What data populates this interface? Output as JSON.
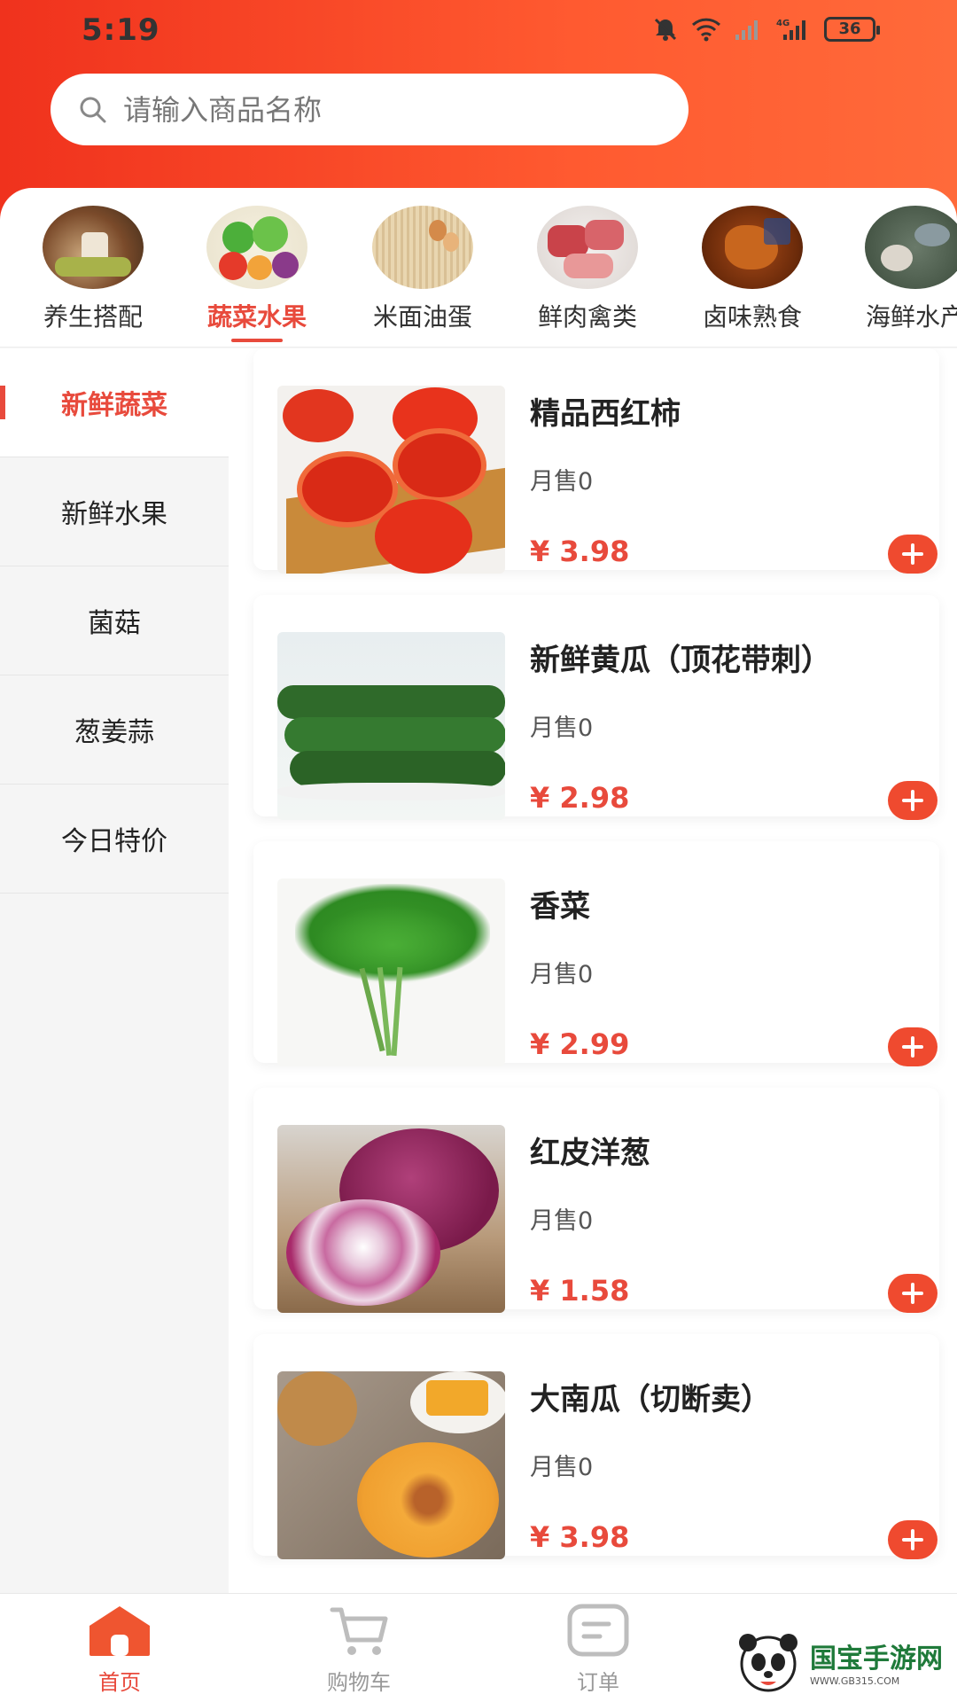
{
  "status_bar": {
    "time": "5:19",
    "battery": "36"
  },
  "search": {
    "placeholder": "请输入商品名称"
  },
  "categories": [
    {
      "label": "养生搭配"
    },
    {
      "label": "蔬菜水果"
    },
    {
      "label": "米面油蛋"
    },
    {
      "label": "鲜肉禽类"
    },
    {
      "label": "卤味熟食"
    },
    {
      "label": "海鲜水产"
    }
  ],
  "sidebar": {
    "items": [
      {
        "label": "新鲜蔬菜"
      },
      {
        "label": "新鲜水果"
      },
      {
        "label": "菌菇"
      },
      {
        "label": "葱姜蒜"
      },
      {
        "label": "今日特价"
      }
    ]
  },
  "products": [
    {
      "name": "精品西红柿",
      "sales": "月售0",
      "price": "¥ 3.98"
    },
    {
      "name": "新鲜黄瓜（顶花带刺）",
      "sales": "月售0",
      "price": "¥ 2.98"
    },
    {
      "name": "香菜",
      "sales": "月售0",
      "price": "¥ 2.99"
    },
    {
      "name": "红皮洋葱",
      "sales": "月售0",
      "price": "¥ 1.58"
    },
    {
      "name": "大南瓜（切断卖）",
      "sales": "月售0",
      "price": "¥ 3.98"
    }
  ],
  "tabbar": {
    "items": [
      {
        "label": "首页"
      },
      {
        "label": "购物车"
      },
      {
        "label": "订单"
      }
    ]
  },
  "watermark": {
    "title": "国宝手游网",
    "url": "WWW.GB315.COM"
  },
  "colors": {
    "accent": "#e84a3c",
    "header_start": "#f0321d",
    "header_end": "#ff6a3a"
  }
}
